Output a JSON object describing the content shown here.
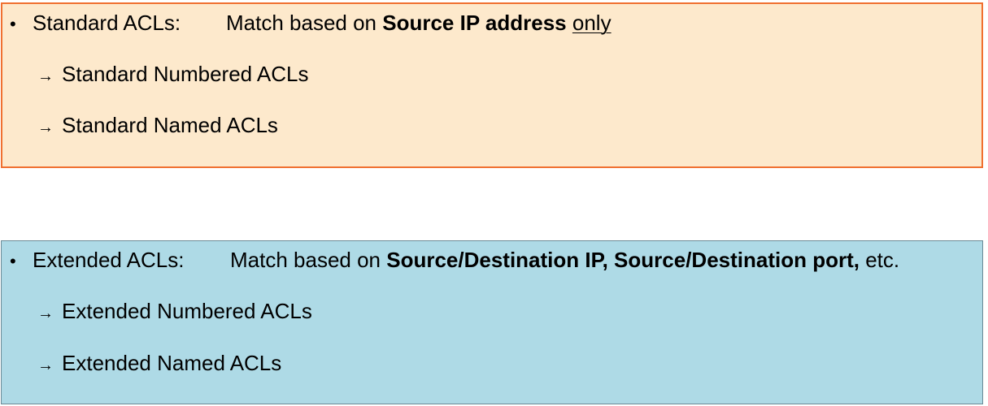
{
  "colors": {
    "standard_fill": "#fde9cc",
    "standard_border": "#f07030",
    "extended_fill": "#aedae6",
    "extended_border": "#6a8a96"
  },
  "standard": {
    "bullet": "•",
    "label": "Standard ACLs:",
    "match_prefix": "Match based on ",
    "match_bold": "Source IP address",
    "match_space": " ",
    "match_underline": "only",
    "items": [
      {
        "arrow": "→",
        "text": "Standard Numbered ACLs"
      },
      {
        "arrow": "→",
        "text": "Standard Named ACLs"
      }
    ]
  },
  "extended": {
    "bullet": "•",
    "label": "Extended ACLs:",
    "match_prefix": "Match based on ",
    "match_bold": "Source/Destination IP, Source/Destination port,",
    "match_suffix": " etc.",
    "items": [
      {
        "arrow": "→",
        "text": "Extended Numbered ACLs"
      },
      {
        "arrow": "→",
        "text": "Extended Named ACLs"
      }
    ]
  }
}
